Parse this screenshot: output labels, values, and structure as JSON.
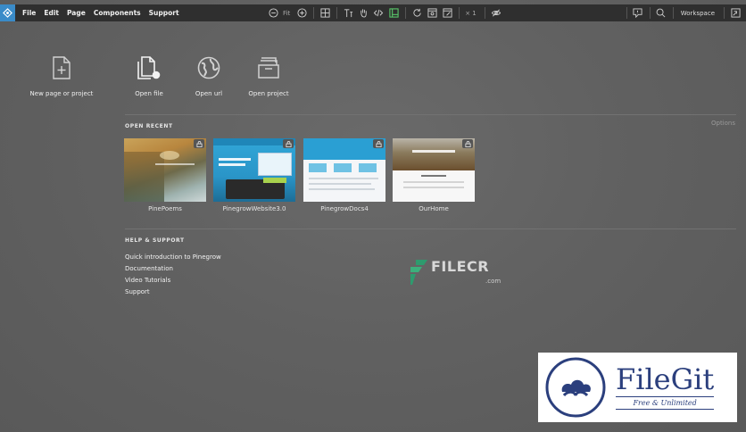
{
  "menu": [
    "File",
    "Edit",
    "Page",
    "Components",
    "Support"
  ],
  "toolbar": {
    "zoom_label": "Fit",
    "multiplier": "× 1",
    "workspace_label": "Workspace",
    "icons": [
      "zoom-out-icon",
      "zoom-in-icon",
      "grid-icon",
      "text-icon",
      "hand-icon",
      "code-icon",
      "layout-icon",
      "refresh-icon",
      "preview-icon",
      "edit-icon",
      "hide-icon",
      "help-icon",
      "search-icon",
      "exit-fullscreen-icon"
    ],
    "active_color": "#58c76a",
    "accent_color": "#3a8bc8"
  },
  "actions": [
    {
      "label": "New page or project",
      "icon": "new-page-icon"
    },
    {
      "label": "Open file",
      "icon": "open-file-icon"
    },
    {
      "label": "Open url",
      "icon": "globe-icon"
    },
    {
      "label": "Open project",
      "icon": "open-project-icon"
    }
  ],
  "recent": {
    "title": "OPEN RECENT",
    "options_label": "Options",
    "items": [
      {
        "label": "PinePoems"
      },
      {
        "label": "PinegrowWebsite3.0"
      },
      {
        "label": "PinegrowDocs4"
      },
      {
        "label": "OurHome"
      }
    ]
  },
  "help": {
    "title": "HELP & SUPPORT",
    "links": [
      "Quick introduction to Pinegrow",
      "Documentation",
      "Video Tutorials",
      "Support"
    ]
  },
  "watermarks": {
    "filecr": "FILECR",
    "filecr_domain": ".com",
    "filegit_title": "FileGit",
    "filegit_sub": "Free & Unlimited"
  }
}
